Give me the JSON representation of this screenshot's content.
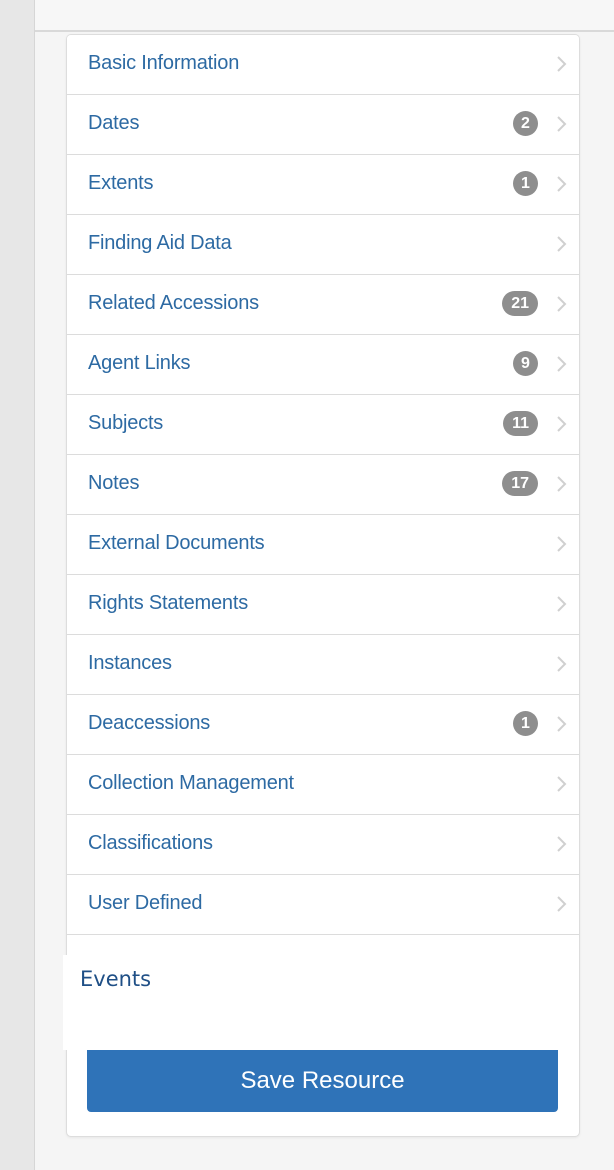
{
  "nav": {
    "items": [
      {
        "label": "Basic Information",
        "count": ""
      },
      {
        "label": "Dates",
        "count": "2"
      },
      {
        "label": "Extents",
        "count": "1"
      },
      {
        "label": "Finding Aid Data",
        "count": ""
      },
      {
        "label": "Related Accessions",
        "count": "21"
      },
      {
        "label": "Agent Links",
        "count": "9"
      },
      {
        "label": "Subjects",
        "count": "11"
      },
      {
        "label": "Notes",
        "count": "17"
      },
      {
        "label": "External Documents",
        "count": ""
      },
      {
        "label": "Rights Statements",
        "count": ""
      },
      {
        "label": "Instances",
        "count": ""
      },
      {
        "label": "Deaccessions",
        "count": "1"
      },
      {
        "label": "Collection Management",
        "count": ""
      },
      {
        "label": "Classifications",
        "count": ""
      },
      {
        "label": "User Defined",
        "count": ""
      }
    ],
    "chevron_icon": "chevron-right-icon",
    "link_color": "#2d6aa3",
    "badge_color": "#8e8e8e"
  },
  "events": {
    "label": "Events"
  },
  "actions": {
    "save_label": "Save Resource",
    "save_color": "#2f73b8"
  }
}
